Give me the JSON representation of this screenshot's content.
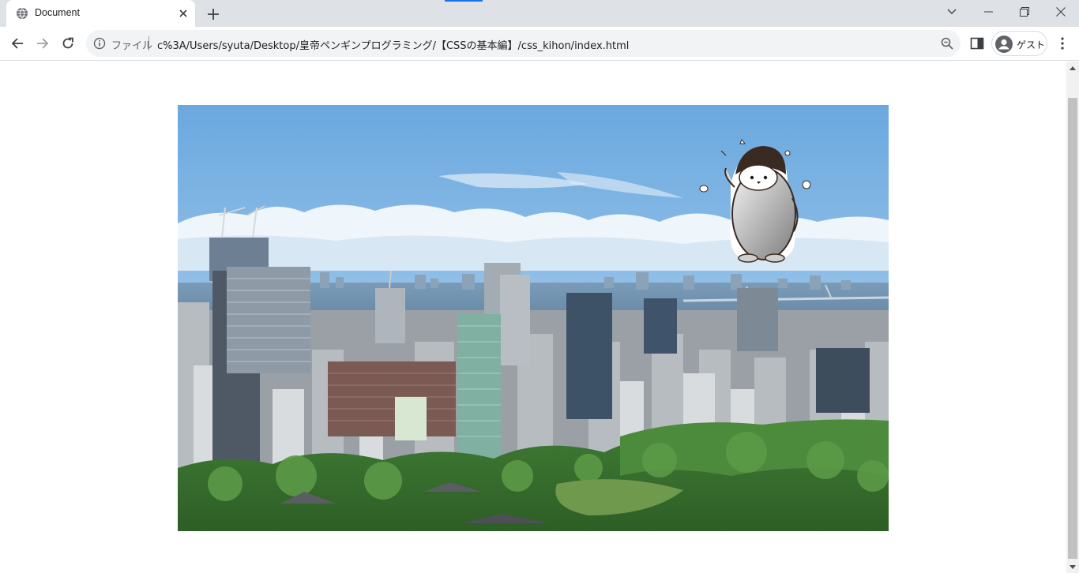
{
  "tab": {
    "title": "Document",
    "favicon": "globe-icon"
  },
  "toolbar": {
    "scheme_label": "ファイル",
    "url": "c%3A/Users/syuta/Desktop/皇帝ペンギンプログラミング/【CSSの基本編】/css_kihon/index.html",
    "profile_label": "ゲスト"
  },
  "icons": {
    "back": "arrow-left-icon",
    "forward": "arrow-right-icon",
    "reload": "reload-icon",
    "info": "info-icon",
    "zoom": "zoom-icon",
    "side_panel": "side-panel-icon",
    "menu": "kebab-menu-icon"
  },
  "content": {
    "image_description": "Tokyo skyline photo with a cartoon baby penguin sticker"
  },
  "colors": {
    "tabstrip": "#dee1e6",
    "omnibox": "#f1f3f4",
    "accent": "#1a73e8"
  }
}
